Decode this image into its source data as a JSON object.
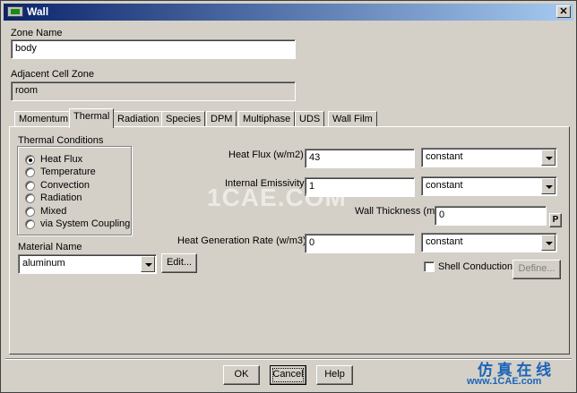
{
  "window": {
    "title": "Wall",
    "close_glyph": "✕"
  },
  "zone": {
    "label": "Zone Name",
    "value": "body"
  },
  "adjacent": {
    "label": "Adjacent Cell Zone",
    "value": "room"
  },
  "tabs": [
    "Momentum",
    "Thermal",
    "Radiation",
    "Species",
    "DPM",
    "Multiphase",
    "UDS",
    "Wall Film"
  ],
  "active_tab": "Thermal",
  "thermal": {
    "group_label": "Thermal Conditions",
    "options": [
      "Heat Flux",
      "Temperature",
      "Convection",
      "Radiation",
      "Mixed",
      "via System Coupling"
    ],
    "selected": "Heat Flux",
    "heat_flux": {
      "label": "Heat Flux (w/m2)",
      "value": "43",
      "method": "constant"
    },
    "emissivity": {
      "label": "Internal Emissivity",
      "value": "1",
      "method": "constant"
    },
    "wall_thickness": {
      "label": "Wall Thickness (m)",
      "value": "0",
      "p_label": "P"
    },
    "heat_gen": {
      "label": "Heat Generation Rate (w/m3)",
      "value": "0",
      "method": "constant"
    },
    "material": {
      "label": "Material Name",
      "value": "aluminum",
      "edit_label": "Edit..."
    },
    "shell": {
      "label": "Shell Conduction",
      "define_label": "Define...",
      "checked": false
    }
  },
  "buttons": {
    "ok": "OK",
    "cancel": "Cancel",
    "help": "Help"
  },
  "watermark": "1CAE.COM",
  "brand": {
    "cn": "仿 真 在 线",
    "url": "www.1CAE.com"
  }
}
